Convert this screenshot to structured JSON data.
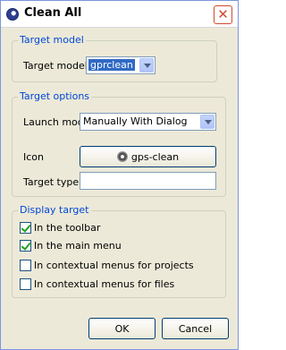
{
  "window": {
    "title": "Clean All"
  },
  "target_model": {
    "legend": "Target model",
    "label": "Target model",
    "value": "gprclean"
  },
  "target_options": {
    "legend": "Target options",
    "launch_mode_label": "Launch mode",
    "launch_mode_value": "Manually With Dialog",
    "icon_label": "Icon",
    "icon_button_label": "gps-clean",
    "icon_name": "gear-icon",
    "target_type_label": "Target type",
    "target_type_value": ""
  },
  "display_target": {
    "legend": "Display target",
    "options": [
      {
        "label": "In the toolbar",
        "checked": true
      },
      {
        "label": "In the main menu",
        "checked": true
      },
      {
        "label": "In contextual menus for projects",
        "checked": false
      },
      {
        "label": "In contextual menus for files",
        "checked": false
      }
    ]
  },
  "buttons": {
    "ok": "OK",
    "cancel": "Cancel"
  },
  "colors": {
    "group_legend": "#0046d5",
    "dialog_bg": "#ece9d8",
    "selection": "#316ac5"
  }
}
